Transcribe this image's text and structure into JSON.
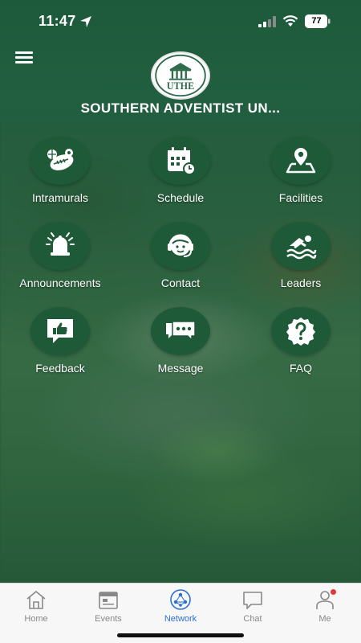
{
  "status_bar": {
    "time": "11:47",
    "battery": "77"
  },
  "header": {
    "title": "SOUTHERN ADVENTIST UN...",
    "logo_text": "UTHE"
  },
  "tiles": [
    {
      "label": "Intramurals",
      "icon": "sports-balls-icon"
    },
    {
      "label": "Schedule",
      "icon": "calendar-clock-icon"
    },
    {
      "label": "Facilities",
      "icon": "map-pin-icon"
    },
    {
      "label": "Announcements",
      "icon": "alarm-bell-icon"
    },
    {
      "label": "Contact",
      "icon": "headset-agent-icon"
    },
    {
      "label": "Leaders",
      "icon": "swimmer-icon"
    },
    {
      "label": "Feedback",
      "icon": "thumbs-up-icon"
    },
    {
      "label": "Message",
      "icon": "chat-bubbles-icon"
    },
    {
      "label": "FAQ",
      "icon": "question-icon"
    }
  ],
  "bottom_nav": {
    "items": [
      {
        "label": "Home",
        "icon": "home-icon"
      },
      {
        "label": "Events",
        "icon": "events-icon"
      },
      {
        "label": "Network",
        "icon": "network-icon"
      },
      {
        "label": "Chat",
        "icon": "chat-icon"
      },
      {
        "label": "Me",
        "icon": "person-icon"
      }
    ],
    "active": "Network"
  },
  "colors": {
    "brand_green": "#1e5a38",
    "active_blue": "#2a6fd6",
    "notification_red": "#e53935"
  }
}
